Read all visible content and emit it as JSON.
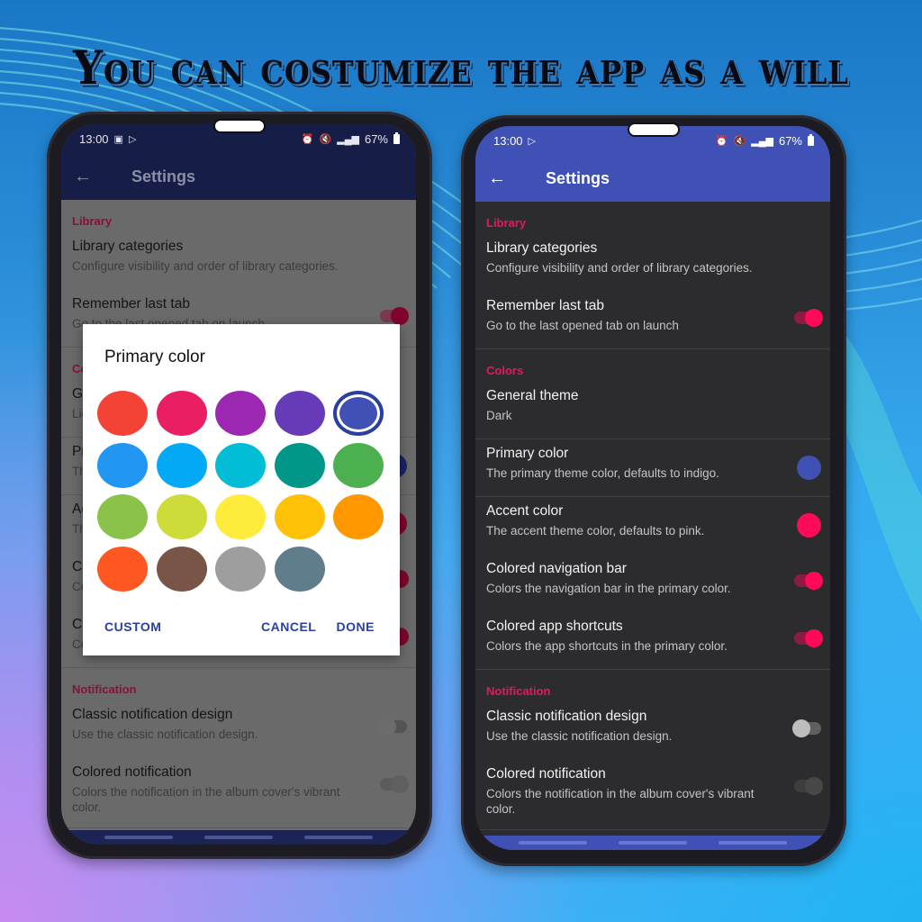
{
  "headline": "You can costumize the app as a will",
  "left_phone": {
    "status_bar": {
      "time": "13:00",
      "left_icons": [
        "image-icon",
        "play-store-icon"
      ],
      "right_icons": [
        "alarm-icon",
        "mute-icon",
        "signal-icon"
      ],
      "battery": "67%"
    },
    "toolbar": {
      "title": "Settings",
      "back_icon": "←"
    },
    "theme": "light-dimmed",
    "sections": [
      {
        "header": "Library",
        "items": [
          {
            "title": "Library categories",
            "summary": "Configure visibility and order of library categories.",
            "control": "none"
          },
          {
            "title": "Remember last tab",
            "summary": "Go to the last opened tab on launch",
            "control": "switch",
            "checked": true
          }
        ]
      },
      {
        "header": "Colors",
        "items": [
          {
            "title": "General theme",
            "summary": "Light",
            "control": "none"
          },
          {
            "title": "Primary color",
            "summary": "The primary theme color, defaults to indigo.",
            "control": "color",
            "color": "#1a2366"
          },
          {
            "title": "Accent color",
            "summary": "The accent theme color, defaults to pink.",
            "control": "color",
            "color": "#80052c"
          },
          {
            "title": "Colored navigation bar",
            "summary": "Colors the navigation bar in the primary color.",
            "control": "switch",
            "checked": true
          },
          {
            "title": "Colored app shortcuts",
            "summary": "Colors the app shortcuts in the primary color.",
            "control": "switch",
            "checked": true
          }
        ]
      },
      {
        "header": "Notification",
        "items": [
          {
            "title": "Classic notification design",
            "summary": "Use the classic notification design.",
            "control": "switch",
            "checked": false
          },
          {
            "title": "Colored notification",
            "summary": "Colors the notification in the album cover's vibrant color.",
            "control": "switch",
            "checked": true,
            "disabled": true
          }
        ]
      }
    ],
    "dialog": {
      "title": "Primary color",
      "swatches": [
        "#f44336",
        "#e91e63",
        "#9c27b0",
        "#673ab7",
        "#3f51b5",
        "#2196f3",
        "#03a9f4",
        "#00bcd4",
        "#009688",
        "#4caf50",
        "#8bc34a",
        "#cddc39",
        "#ffeb3b",
        "#ffc107",
        "#ff9800",
        "#ff5722",
        "#795548",
        "#9e9e9e",
        "#607d8b"
      ],
      "selected_index": 4,
      "buttons": {
        "custom": "CUSTOM",
        "cancel": "CANCEL",
        "done": "DONE"
      }
    }
  },
  "right_phone": {
    "status_bar": {
      "time": "13:00",
      "left_icons": [
        "play-store-icon"
      ],
      "right_icons": [
        "alarm-icon",
        "mute-icon",
        "signal-icon"
      ],
      "battery": "67%"
    },
    "toolbar": {
      "title": "Settings",
      "back_icon": "←"
    },
    "theme": "dark",
    "sections": [
      {
        "header": "Library",
        "items": [
          {
            "title": "Library categories",
            "summary": "Configure visibility and order of library categories.",
            "control": "none"
          },
          {
            "title": "Remember last tab",
            "summary": "Go to the last opened tab on launch",
            "control": "switch",
            "checked": true
          }
        ]
      },
      {
        "header": "Colors",
        "items": [
          {
            "title": "General theme",
            "summary": "Dark",
            "control": "none"
          },
          {
            "title": "Primary color",
            "summary": "The primary theme color, defaults to indigo.",
            "control": "color",
            "color": "#3f51b5"
          },
          {
            "title": "Accent color",
            "summary": "The accent theme color, defaults to pink.",
            "control": "color",
            "color": "#ff0a59"
          },
          {
            "title": "Colored navigation bar",
            "summary": "Colors the navigation bar in the primary color.",
            "control": "switch",
            "checked": true
          },
          {
            "title": "Colored app shortcuts",
            "summary": "Colors the app shortcuts in the primary color.",
            "control": "switch",
            "checked": true
          }
        ]
      },
      {
        "header": "Notification",
        "items": [
          {
            "title": "Classic notification design",
            "summary": "Use the classic notification design.",
            "control": "switch",
            "checked": false
          },
          {
            "title": "Colored notification",
            "summary": "Colors the notification in the album cover's vibrant color.",
            "control": "switch",
            "checked": true,
            "disabled": true
          }
        ]
      }
    ]
  }
}
